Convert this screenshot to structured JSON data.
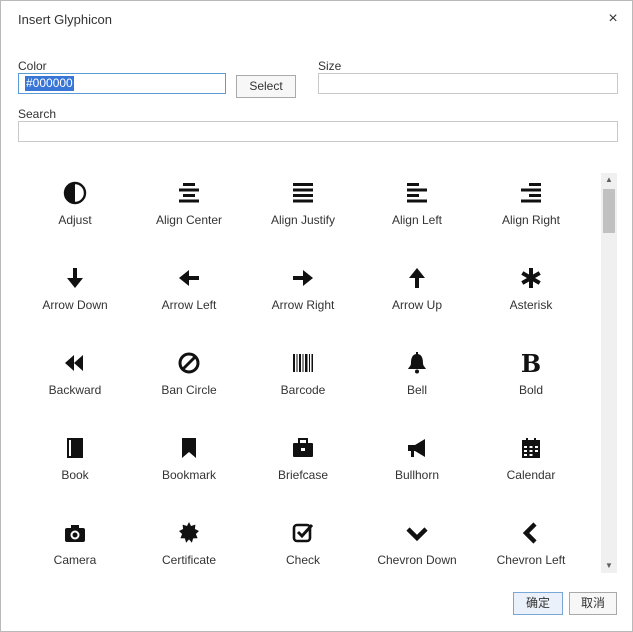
{
  "dialog": {
    "title": "Insert Glyphicon",
    "close_glyph": "×"
  },
  "color": {
    "label": "Color",
    "value": "#000000",
    "select_label": "Select"
  },
  "size": {
    "label": "Size",
    "value": ""
  },
  "search": {
    "label": "Search",
    "value": ""
  },
  "glyphs": [
    {
      "name": "Adjust",
      "icon": "adjust-icon"
    },
    {
      "name": "Align Center",
      "icon": "align-center-icon"
    },
    {
      "name": "Align Justify",
      "icon": "align-justify-icon"
    },
    {
      "name": "Align Left",
      "icon": "align-left-icon"
    },
    {
      "name": "Align Right",
      "icon": "align-right-icon"
    },
    {
      "name": "Arrow Down",
      "icon": "arrow-down-icon"
    },
    {
      "name": "Arrow Left",
      "icon": "arrow-left-icon"
    },
    {
      "name": "Arrow Right",
      "icon": "arrow-right-icon"
    },
    {
      "name": "Arrow Up",
      "icon": "arrow-up-icon"
    },
    {
      "name": "Asterisk",
      "icon": "asterisk-icon"
    },
    {
      "name": "Backward",
      "icon": "backward-icon"
    },
    {
      "name": "Ban Circle",
      "icon": "ban-circle-icon"
    },
    {
      "name": "Barcode",
      "icon": "barcode-icon"
    },
    {
      "name": "Bell",
      "icon": "bell-icon"
    },
    {
      "name": "Bold",
      "icon": "bold-icon"
    },
    {
      "name": "Book",
      "icon": "book-icon"
    },
    {
      "name": "Bookmark",
      "icon": "bookmark-icon"
    },
    {
      "name": "Briefcase",
      "icon": "briefcase-icon"
    },
    {
      "name": "Bullhorn",
      "icon": "bullhorn-icon"
    },
    {
      "name": "Calendar",
      "icon": "calendar-icon"
    },
    {
      "name": "Camera",
      "icon": "camera-icon"
    },
    {
      "name": "Certificate",
      "icon": "certificate-icon"
    },
    {
      "name": "Check",
      "icon": "check-icon"
    },
    {
      "name": "Chevron Down",
      "icon": "chevron-down-icon"
    },
    {
      "name": "Chevron Left",
      "icon": "chevron-left-icon"
    }
  ],
  "footer": {
    "ok_label": "确定",
    "cancel_label": "取消"
  }
}
